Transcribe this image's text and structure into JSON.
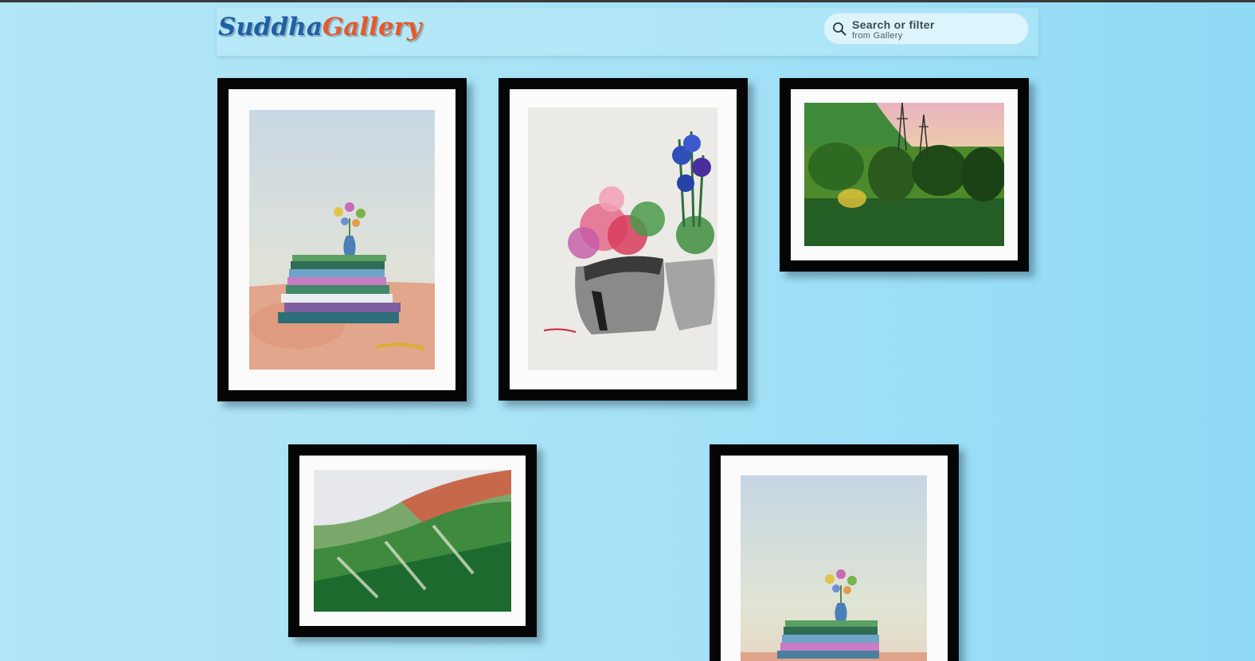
{
  "header": {
    "logo_part1": "Suddha",
    "logo_part2": "Gallery",
    "logo_color1": "#1f5fa8",
    "logo_color2": "#e8582a",
    "search": {
      "title": "Search or filter",
      "subtitle": "from Gallery",
      "icon": "search-icon"
    }
  },
  "gallery": {
    "paintings": [
      {
        "subject": "books-with-flower-vase",
        "orientation": "portrait"
      },
      {
        "subject": "flowers-in-pots",
        "orientation": "portrait"
      },
      {
        "subject": "forest-with-power-towers",
        "orientation": "landscape"
      },
      {
        "subject": "green-hills-landscape",
        "orientation": "landscape"
      },
      {
        "subject": "books-with-flower-vase",
        "orientation": "portrait"
      }
    ]
  }
}
